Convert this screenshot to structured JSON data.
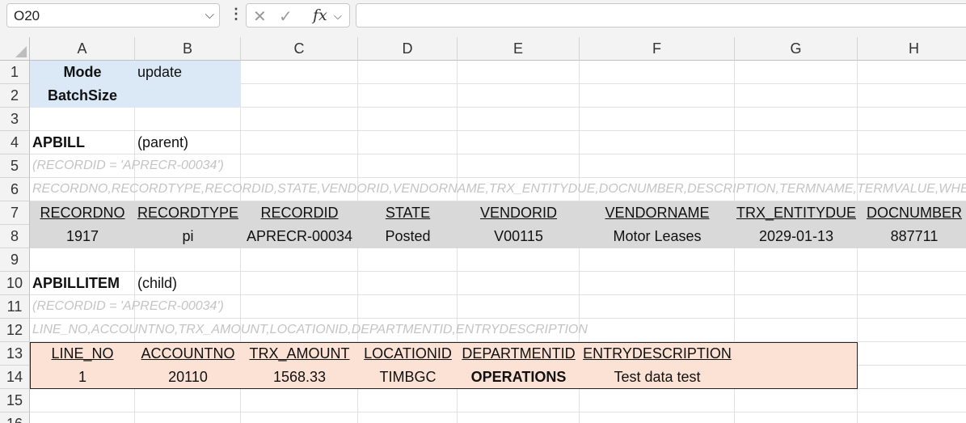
{
  "name_box": {
    "value": "O20"
  },
  "formula_bar": {
    "fx_label": "fx",
    "value": ""
  },
  "columns": [
    "A",
    "B",
    "C",
    "D",
    "E",
    "F",
    "G",
    "H"
  ],
  "rows": [
    "1",
    "2",
    "3",
    "4",
    "5",
    "6",
    "7",
    "8",
    "9",
    "10",
    "11",
    "12",
    "13",
    "14",
    "15",
    "16"
  ],
  "cells": {
    "A1": "Mode",
    "B1": "update",
    "A2": "BatchSize",
    "A4": "APBILL",
    "B4": "(parent)",
    "A5": "(RECORDID = 'APRECR-00034')",
    "A6": "RECORDNO,RECORDTYPE,RECORDID,STATE,VENDORID,VENDORNAME,TRX_ENTITYDUE,DOCNUMBER,DESCRIPTION,TERMNAME,TERMVALUE,WHENCREATED,V",
    "parent_headers": [
      "RECORDNO",
      "RECORDTYPE",
      "RECORDID",
      "STATE",
      "VENDORID",
      "VENDORNAME",
      "TRX_ENTITYDUE",
      "DOCNUMBER"
    ],
    "parent_values": [
      "1917",
      "pi",
      "APRECR-00034",
      "Posted",
      "V00115",
      "Motor Leases",
      "2029-01-13",
      "887711"
    ],
    "A10": "APBILLITEM",
    "B10": "(child)",
    "A11": "(RECORDID = 'APRECR-00034')",
    "A12": "LINE_NO,ACCOUNTNO,TRX_AMOUNT,LOCATIONID,DEPARTMENTID,ENTRYDESCRIPTION",
    "child_headers": [
      "LINE_NO",
      "ACCOUNTNO",
      "TRX_AMOUNT",
      "LOCATIONID",
      "DEPARTMENTID",
      "ENTRYDESCRIPTION"
    ],
    "child_values": [
      "1",
      "20110",
      "1568.33",
      "TIMBGC",
      "OPERATIONS",
      "Test data test"
    ]
  }
}
